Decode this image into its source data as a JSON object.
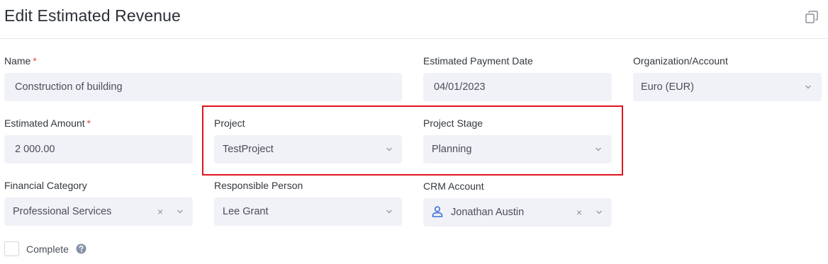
{
  "header": {
    "title": "Edit Estimated Revenue",
    "copy_icon": "copy-icon"
  },
  "form": {
    "name": {
      "label": "Name",
      "required": "*",
      "value": "Construction of building"
    },
    "estimated_payment_date": {
      "label": "Estimated Payment Date",
      "value": "04/01/2023"
    },
    "organization_account": {
      "label": "Organization/Account",
      "value": "Euro (EUR)"
    },
    "estimated_amount": {
      "label": "Estimated Amount",
      "required": "*",
      "value": "2 000.00"
    },
    "project": {
      "label": "Project",
      "value": "TestProject"
    },
    "project_stage": {
      "label": "Project Stage",
      "value": "Planning"
    },
    "financial_category": {
      "label": "Financial Category",
      "value": "Professional Services",
      "clear": "×"
    },
    "responsible_person": {
      "label": "Responsible Person",
      "value": "Lee Grant"
    },
    "crm_account": {
      "label": "CRM Account",
      "value": "Jonathan Austin",
      "clear": "×",
      "icon": "user-icon"
    },
    "complete": {
      "label": "Complete",
      "checked": false,
      "help_icon": "help-icon"
    }
  },
  "colors": {
    "highlight": "#e0141e",
    "required": "#e5484d",
    "field_bg": "#f1f2f7",
    "user_icon": "#3b6fd8",
    "help_icon": "#8592a8"
  }
}
